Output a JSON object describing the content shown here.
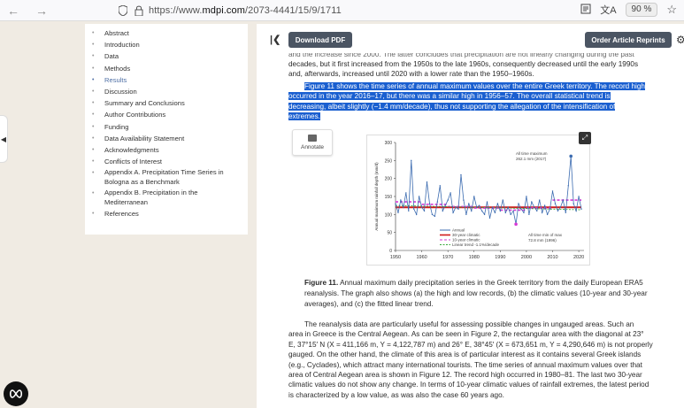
{
  "browser": {
    "url_prefix": "https://www.",
    "url_domain": "mdpi.com",
    "url_path": "/2073-4441/15/9/1711",
    "zoom": "90 %"
  },
  "toc": {
    "items": [
      {
        "label": "Abstract",
        "active": false
      },
      {
        "label": "Introduction",
        "active": false
      },
      {
        "label": "Data",
        "active": false
      },
      {
        "label": "Methods",
        "active": false
      },
      {
        "label": "Results",
        "active": true
      },
      {
        "label": "Discussion",
        "active": false
      },
      {
        "label": "Summary and Conclusions",
        "active": false
      },
      {
        "label": "Author Contributions",
        "active": false
      },
      {
        "label": "Funding",
        "active": false
      },
      {
        "label": "Data Availability Statement",
        "active": false
      },
      {
        "label": "Acknowledgments",
        "active": false
      },
      {
        "label": "Conflicts of Interest",
        "active": false
      },
      {
        "label": "Appendix A. Precipitation Time Series in Bologna as a Benchmark",
        "active": false
      },
      {
        "label": "Appendix B. Precipitation in the Mediterranean",
        "active": false
      },
      {
        "label": "References",
        "active": false
      }
    ]
  },
  "toolbar": {
    "download_label": "Download PDF",
    "order_label": "Order Article Reprints"
  },
  "paragraph1": {
    "line0": "and the increase since 2000. The latter concludes that precipitation are not linearly changing during the past",
    "line1": "decades, but it first increased from the 1950s to the late 1960s, consequently decreased until the early 1990s",
    "line2": "and, afterwards, increased until 2020 with a lower rate than the 1950–1960s."
  },
  "highlight": {
    "line1": "Figure 11 shows the time series of annual maximum values over the entire Greek territory. The record high",
    "line2": "occurred in the year 2016–17, but there was a similar high in 1956–57. The overall statistical trend is",
    "line3": "decreasing, albeit slightly (−1.4 mm/decade), thus not supporting the allegation of the intensification of",
    "line4": "extremes."
  },
  "annotate_label": "Annotate",
  "caption": {
    "label": "Figure 11.",
    "text": "Annual maximum daily precipitation series in the Greek territory from the daily European ERA5 reanalysis. The graph also shows (a) the high and low records, (b) the climatic values (10-year and 30-year averages), and (c) the fitted linear trend."
  },
  "paragraph2": {
    "lines": [
      "The reanalysis data are particularly useful for assessing possible changes in ungauged areas. Such an",
      "area in Greece is the Central Aegean. As can be seen in Figure 2, the rectangular area with the diagonal at 23°",
      "E, 37°15′ N (X = 411,166 m, Y = 4,122,787 m) and 26° E, 38°45′ (X = 673,651 m, Y = 4,290,646 m) is not properly",
      "gauged. On the other hand, the climate of this area is of particular interest as it contains several Greek islands",
      "(e.g., Cyclades), which attract many international tourists. The time series of annual maximum values over that",
      "area of Central Aegean area is shown in Figure 12. The record high occurred in 1980–81. The last two 30-year",
      "climatic values do not show any change. In terms of 10-year climatic values of rainfall extremes, the latest period",
      "is characterized by a low value, as was also the case 60 years ago."
    ]
  },
  "colors": {
    "highlight": "#1a5fd0",
    "annual": "#3b6bb0",
    "climatic30": "#d11a1a",
    "climatic10": "#d63ad6",
    "trend": "#3aa83a"
  },
  "chart_data": {
    "type": "line",
    "ylabel": "Annual maximum rainfall depth (mm/d)",
    "xlim": [
      1950,
      2022
    ],
    "ylim": [
      0,
      300
    ],
    "xticks": [
      1950,
      1960,
      1970,
      1980,
      1990,
      2000,
      2010,
      2020
    ],
    "yticks": [
      0,
      50,
      100,
      150,
      200,
      250,
      300
    ],
    "annotations": {
      "max": "All time maximum\n262.1 mm (2017)",
      "min": "All time min of max\n72.8 mm (1996)"
    },
    "legend": [
      "Annual",
      "30-year climatic",
      "10-year climatic",
      "Linear trend -1.1%/decade"
    ],
    "annual": {
      "x": [
        1950,
        1951,
        1952,
        1953,
        1954,
        1955,
        1956,
        1957,
        1958,
        1959,
        1960,
        1961,
        1962,
        1963,
        1964,
        1965,
        1966,
        1967,
        1968,
        1969,
        1970,
        1971,
        1972,
        1973,
        1974,
        1975,
        1976,
        1977,
        1978,
        1979,
        1980,
        1981,
        1982,
        1983,
        1984,
        1985,
        1986,
        1987,
        1988,
        1989,
        1990,
        1991,
        1992,
        1993,
        1994,
        1995,
        1996,
        1997,
        1998,
        1999,
        2000,
        2001,
        2002,
        2003,
        2004,
        2005,
        2006,
        2007,
        2008,
        2009,
        2010,
        2011,
        2012,
        2013,
        2014,
        2015,
        2016,
        2017,
        2018,
        2019,
        2020,
        2021
      ],
      "y": [
        130,
        105,
        140,
        120,
        160,
        110,
        250,
        115,
        100,
        150,
        120,
        110,
        190,
        130,
        100,
        95,
        135,
        180,
        110,
        125,
        140,
        160,
        105,
        120,
        115,
        210,
        140,
        100,
        130,
        110,
        150,
        120,
        125,
        110,
        100,
        135,
        90,
        120,
        105,
        130,
        110,
        140,
        105,
        120,
        100,
        110,
        73,
        130,
        115,
        105,
        150,
        100,
        135,
        120,
        110,
        140,
        105,
        125,
        100,
        115,
        165,
        130,
        110,
        120,
        140,
        105,
        180,
        262,
        130,
        110,
        150,
        115
      ]
    },
    "climatic30": {
      "x": [
        1950,
        2021
      ],
      "y": [
        120,
        120
      ]
    },
    "climatic10": {
      "segments": [
        {
          "x": [
            1950,
            1960
          ],
          "y": [
            135,
            135
          ]
        },
        {
          "x": [
            1960,
            1970
          ],
          "y": [
            128,
            128
          ]
        },
        {
          "x": [
            1970,
            1980
          ],
          "y": [
            122,
            122
          ]
        },
        {
          "x": [
            1980,
            1990
          ],
          "y": [
            118,
            118
          ]
        },
        {
          "x": [
            1990,
            2000
          ],
          "y": [
            112,
            112
          ]
        },
        {
          "x": [
            2000,
            2010
          ],
          "y": [
            118,
            118
          ]
        },
        {
          "x": [
            2010,
            2021
          ],
          "y": [
            140,
            140
          ]
        }
      ]
    },
    "trend": {
      "x": [
        1950,
        2021
      ],
      "y": [
        125,
        113
      ]
    },
    "max_point": {
      "x": 2017,
      "y": 262
    },
    "min_point": {
      "x": 1996,
      "y": 73
    }
  }
}
